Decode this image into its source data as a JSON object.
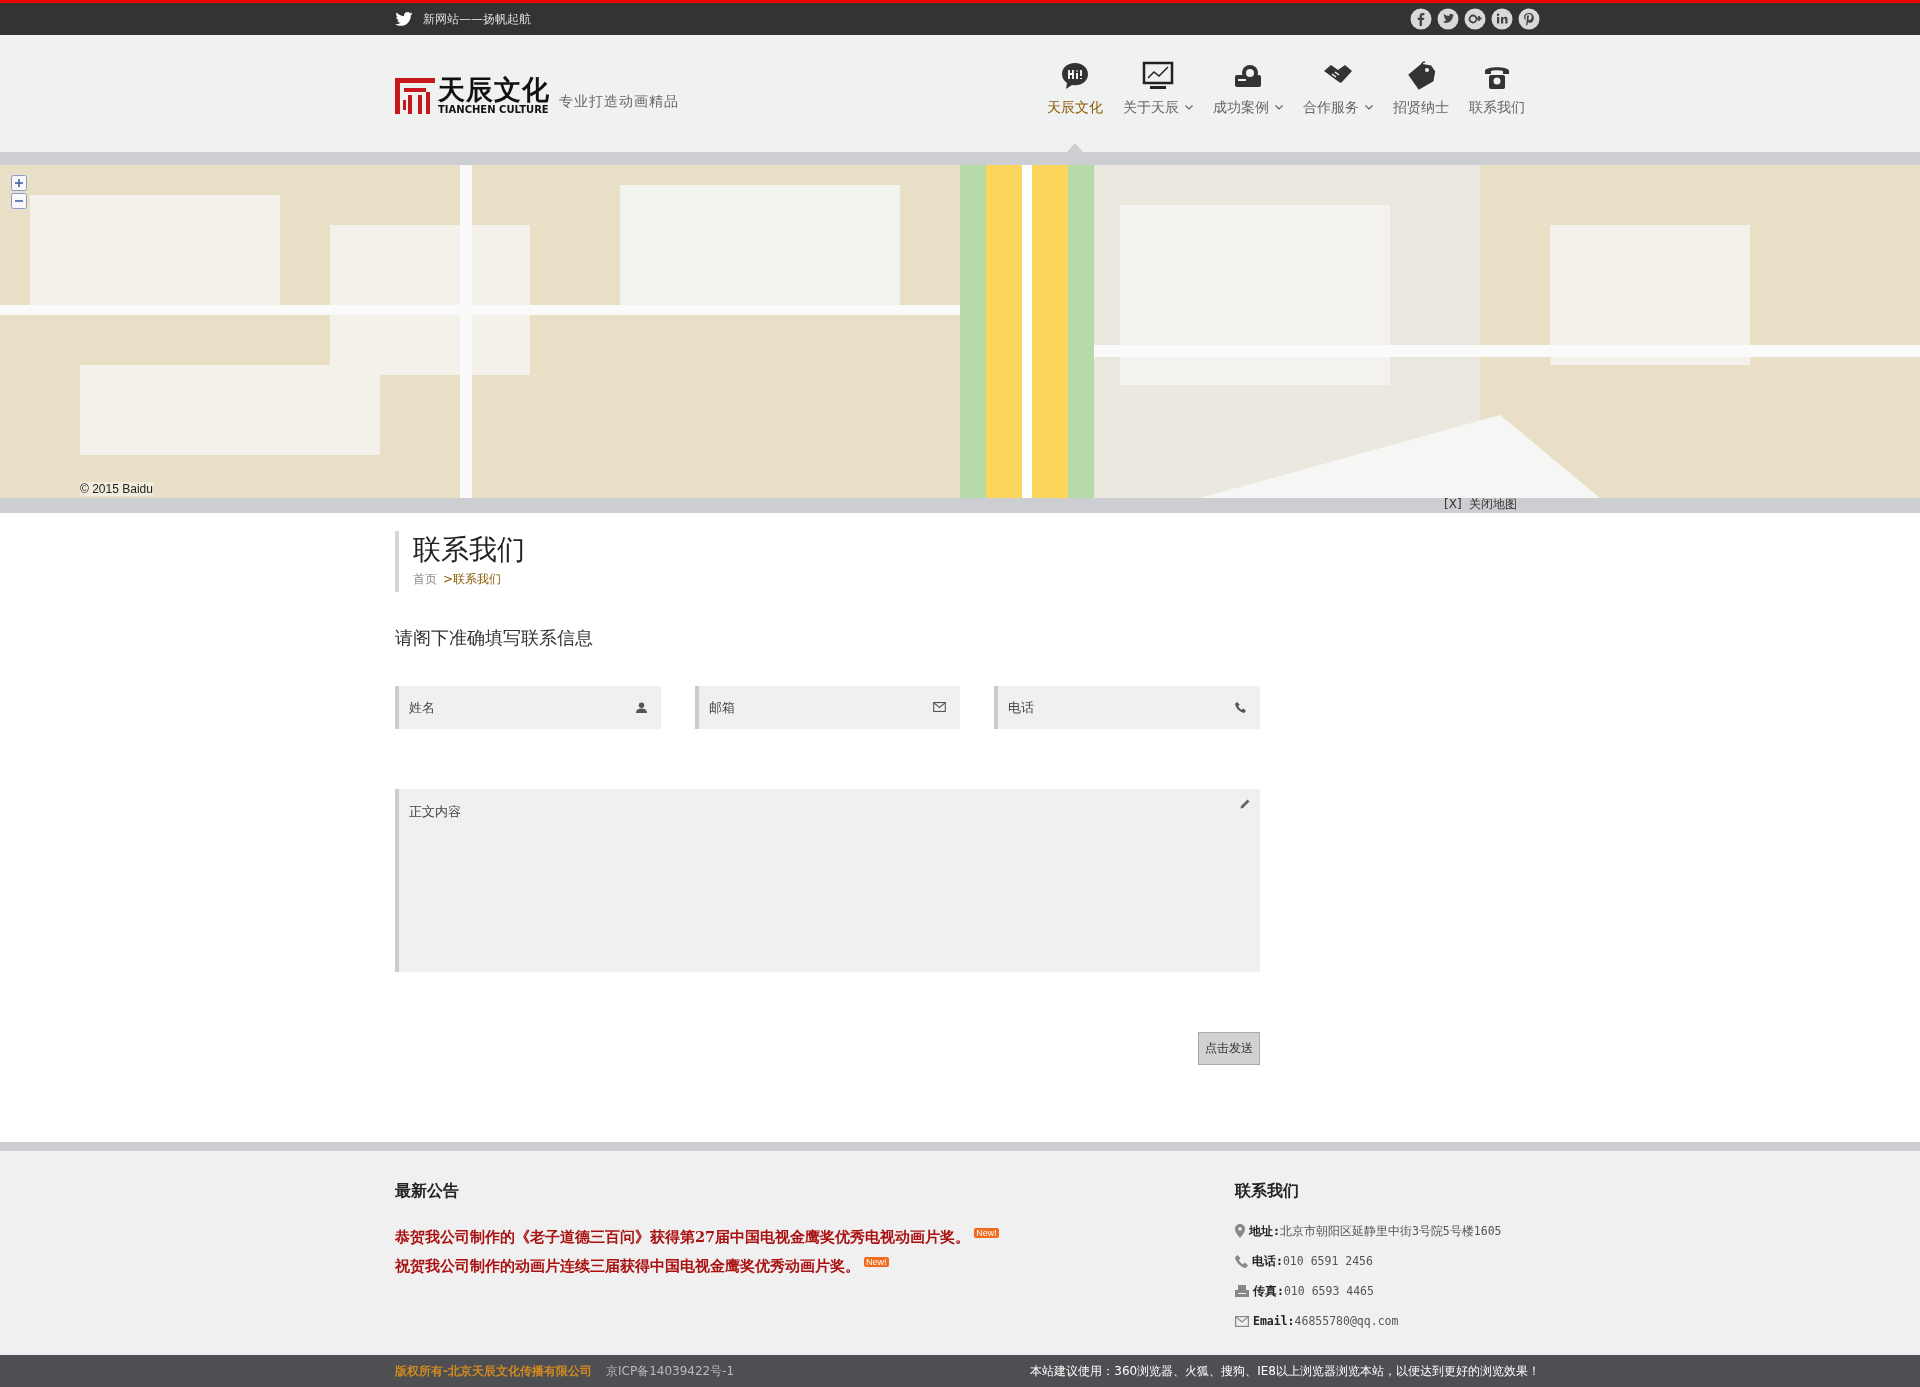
{
  "top_bar": {
    "slogan": "新网站——扬帆起航"
  },
  "header": {
    "logo_cn": "天辰文化",
    "logo_en": "TIANCHEN CULTURE",
    "tagline": "专业打造动画精品",
    "nav": [
      {
        "label": "天辰文化",
        "selected": true,
        "has_menu": false
      },
      {
        "label": "关于天辰",
        "selected": false,
        "has_menu": true
      },
      {
        "label": "成功案例",
        "selected": false,
        "has_menu": true
      },
      {
        "label": "合作服务",
        "selected": false,
        "has_menu": true
      },
      {
        "label": "招贤纳士",
        "selected": false,
        "has_menu": false
      },
      {
        "label": "联系我们",
        "selected": false,
        "has_menu": false
      }
    ]
  },
  "map": {
    "copyright": "© 2015 Baidu",
    "close_link": "[X]  关闭地图"
  },
  "page": {
    "title": "联系我们",
    "breadcrumb": [
      {
        "label": "首页",
        "selected": false
      },
      {
        "label": ">联系我们",
        "selected": true
      }
    ],
    "prompt": "请阁下准确填写联系信息",
    "fields": [
      {
        "placeholder": "姓名"
      },
      {
        "placeholder": "邮箱"
      },
      {
        "placeholder": "电话"
      }
    ],
    "message": {
      "placeholder": "正文内容"
    },
    "submit": "点击发送"
  },
  "footer": {
    "notices_title": "最新公告",
    "notices": [
      {
        "text": "恭贺我公司制作的《老子道德三百问》获得第27届中国电视金鹰奖优秀电视动画片奖。",
        "badge": "New!"
      },
      {
        "text": "祝贺我公司制作的动画片连续三届获得中国电视金鹰奖优秀动画片奖。",
        "badge": "New!"
      }
    ],
    "contact_title": "联系我们",
    "contact": [
      {
        "kind": "address",
        "text": "**地址:**北京市朝阳区延静里中街3号院5号楼1605"
      },
      {
        "kind": "phone",
        "text": "**电话:**010 6591 2456"
      },
      {
        "kind": "fax",
        "text": "**传真:**010 6593 4465"
      },
      {
        "kind": "email",
        "text": "**Email:**46855780@qq.com"
      }
    ]
  },
  "bottom_bar": {
    "copyright": "版权所有-北京天辰文化传播有限公司",
    "icp": "京ICP备14039422号-1",
    "browser_note": "本站建议使用：360浏览器、火狐、搜狗、IE8以上浏览器浏览本站，以便达到更好的浏览效果！"
  }
}
